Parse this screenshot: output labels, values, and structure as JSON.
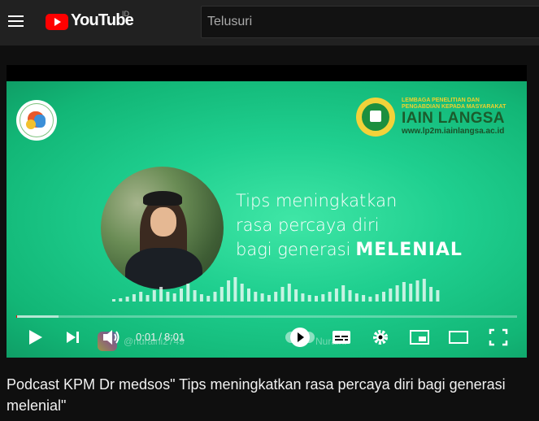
{
  "header": {
    "logo_text": "YouTube",
    "region_code": "ID",
    "search_placeholder": "Telusuri"
  },
  "video": {
    "institution": {
      "line1": "LEMBAGA PENELITIAN DAN",
      "line2": "PENGABDIAN KEPADA MASYARAKAT",
      "name": "IAIN LANGSA",
      "url": "www.lp2m.iainlangsa.ac.id"
    },
    "headline": {
      "line1": "Tips meningkatkan",
      "line2": "rasa percaya diri",
      "line3": "bagi generasi",
      "accent": "MELENIAL"
    },
    "watermark_left": "@nuraini2749",
    "watermark_right": "Nuraini"
  },
  "player": {
    "current_time": "0:01",
    "separator": "/",
    "duration": "8:01",
    "progress": 0.002,
    "buffered": 0.085,
    "autoplay_on": true,
    "icons": [
      "play-icon",
      "next-icon",
      "volume-icon",
      "autoplay-toggle",
      "subtitles-icon",
      "settings-icon",
      "miniplayer-icon",
      "theater-icon",
      "fullscreen-icon"
    ]
  },
  "title": "Podcast KPM Dr medsos\" Tips meningkatkan rasa percaya diri bagi generasi melenial\"",
  "colors": {
    "accent": "#ff0000",
    "background": "#0f0f0f",
    "header": "#212121",
    "video_green": "#1fcf8f"
  }
}
